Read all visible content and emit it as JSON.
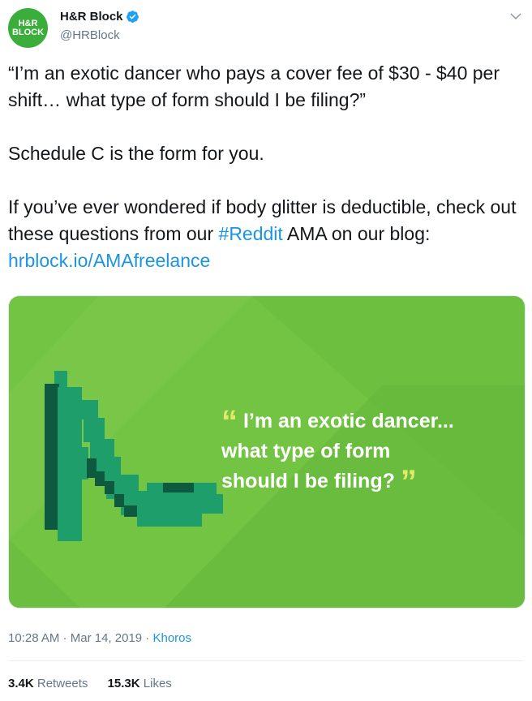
{
  "account": {
    "logo_text": "H&R\nBLOCK",
    "display_name": "H&R Block",
    "handle": "@HRBlock"
  },
  "tweet": {
    "line1": "“I’m an exotic dancer who pays a cover fee of $30 - $40 per shift… what type of form should I be filing?”",
    "line2": "Schedule C is the form for you.",
    "line3_prefix": "If you’ve ever wondered if body glitter is deductible, check out these questions from our ",
    "hashtag": "#Reddit",
    "line3_mid": " AMA on our blog: ",
    "url": "hrblock.io/AMAfreelance"
  },
  "media": {
    "quote_line1": "I’m an exotic dancer...",
    "quote_line2": "what type of form",
    "quote_line3": "should I be filing?",
    "open_quote": "“",
    "close_quote": "”"
  },
  "meta": {
    "time": "10:28 AM",
    "separator": " · ",
    "date": "Mar 14, 2019",
    "source": "Khoros"
  },
  "stats": {
    "retweets_count": "3.4K",
    "retweets_label": "Retweets",
    "likes_count": "15.3K",
    "likes_label": "Likes"
  },
  "colors": {
    "brand_green": "#3aad3b",
    "link_blue": "#1b95e0",
    "media_green": "#6cbf3f",
    "shoe_green": "#1e9e6a",
    "quote_yellow": "#e2e96a"
  }
}
